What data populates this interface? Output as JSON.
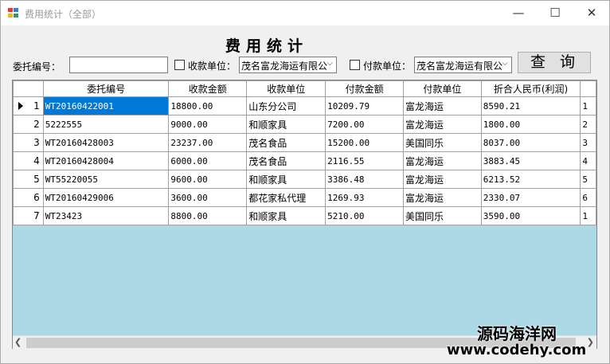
{
  "window": {
    "title": "费用统计（全部）",
    "controls": {
      "minimize": "—",
      "maximize": "☐",
      "close": "✕"
    }
  },
  "form": {
    "title": "费用统计",
    "entrust_label": "委托编号：",
    "entrust_value": "",
    "receive_unit_label": "收款单位：",
    "receive_unit_checked": false,
    "receive_unit_value": "茂名富龙海运有限公",
    "pay_unit_label": "付款单位：",
    "pay_unit_checked": false,
    "pay_unit_value": "茂名富龙海运有限公",
    "query_button": "查询"
  },
  "grid": {
    "columns": [
      "委托编号",
      "收款金额",
      "收款单位",
      "付款金额",
      "付款单位",
      "折合人民币(利润)",
      ""
    ],
    "rows": [
      {
        "num": "1",
        "cells": [
          "WT20160422001",
          "18800.00",
          "山东分公司",
          "10209.79",
          "富龙海运",
          "8590.21",
          "1"
        ]
      },
      {
        "num": "2",
        "cells": [
          "5222555",
          "9000.00",
          "和顺家具",
          "7200.00",
          "富龙海运",
          "1800.00",
          "2"
        ]
      },
      {
        "num": "3",
        "cells": [
          "WT20160428003",
          "23237.00",
          "茂名食品",
          "15200.00",
          "美国同乐",
          "8037.00",
          "3"
        ]
      },
      {
        "num": "4",
        "cells": [
          "WT20160428004",
          "6000.00",
          "茂名食品",
          "2116.55",
          "富龙海运",
          "3883.45",
          "4"
        ]
      },
      {
        "num": "5",
        "cells": [
          "WT55220055",
          "9600.00",
          "和顺家具",
          "3386.48",
          "富龙海运",
          "6213.52",
          "5"
        ]
      },
      {
        "num": "6",
        "cells": [
          "WT20160429006",
          "3600.00",
          "都花家私代理",
          "1269.93",
          "富龙海运",
          "2330.07",
          "6"
        ]
      },
      {
        "num": "7",
        "cells": [
          "WT23423",
          "8800.00",
          "和顺家具",
          "5210.00",
          "美国同乐",
          "3590.00",
          "1"
        ]
      }
    ]
  },
  "watermark": {
    "line1": "源码海洋网",
    "line2": "www.codehy.com"
  },
  "colors": {
    "selection": "#0078d7",
    "grid_background": "#add8e6",
    "window_background": "#f0f0f0"
  }
}
